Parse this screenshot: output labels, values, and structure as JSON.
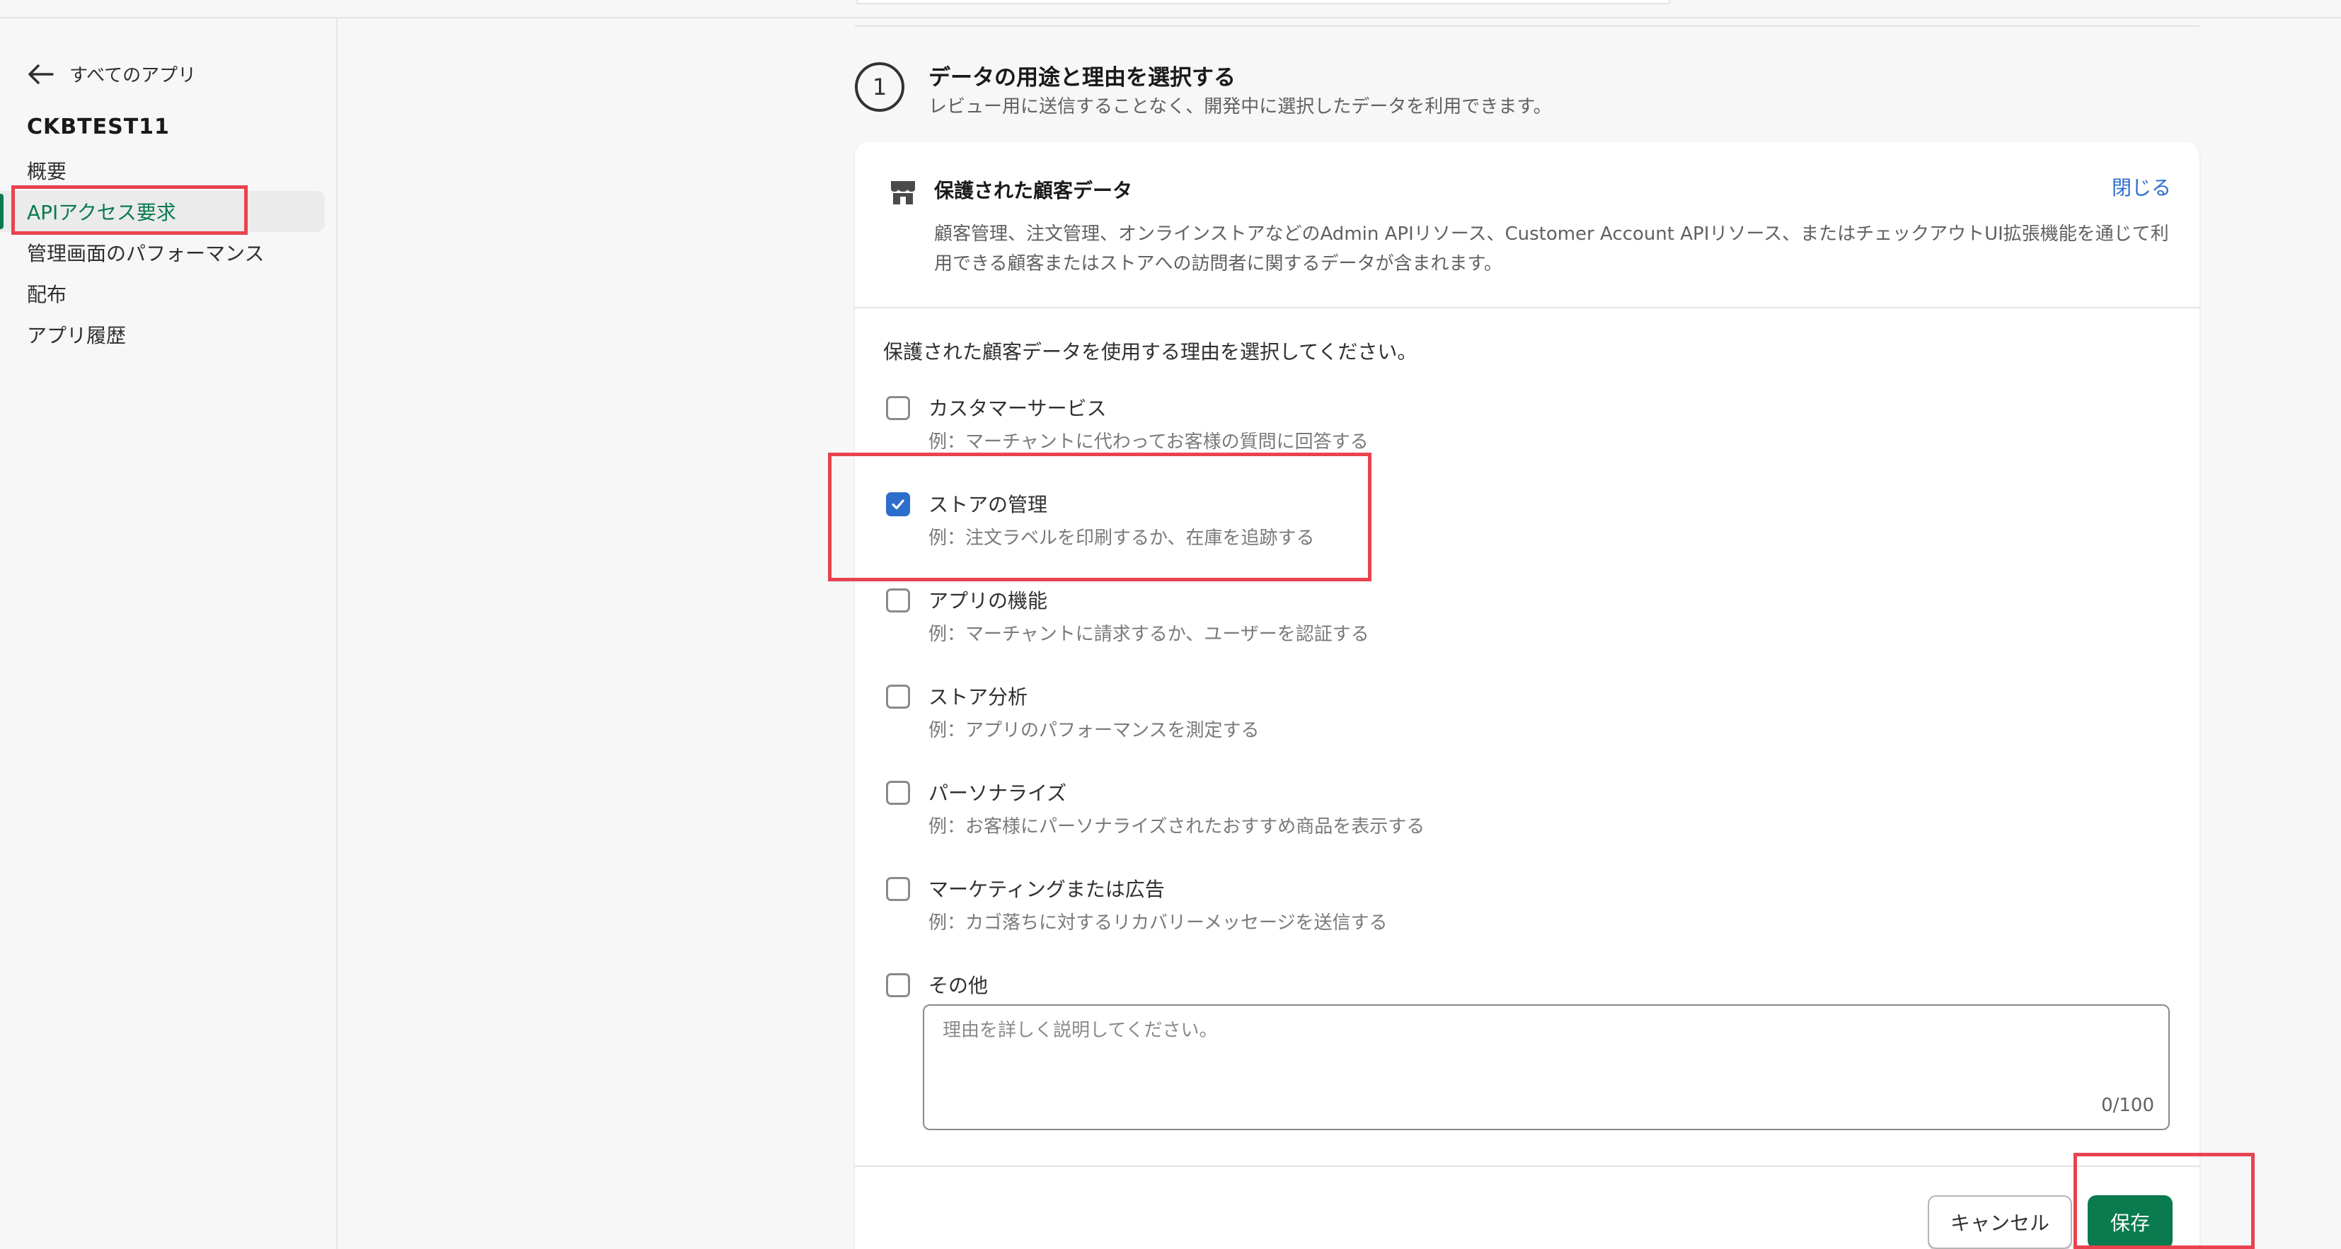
{
  "sidebar": {
    "back_label": "すべてのアプリ",
    "app_name": "CKBTEST11",
    "items": [
      {
        "label": "概要"
      },
      {
        "label": "APIアクセス要求"
      },
      {
        "label": "管理画面のパフォーマンス"
      },
      {
        "label": "配布"
      },
      {
        "label": "アプリ履歴"
      }
    ]
  },
  "section": {
    "step_number": "1",
    "title": "データの用途と理由を選択する",
    "subtitle": "レビュー用に送信することなく、開発中に選択したデータを利用できます。"
  },
  "card": {
    "title": "保護された顧客データ",
    "close_label": "閉じる",
    "description": "顧客管理、注文管理、オンラインストアなどのAdmin APIリソース、Customer Account APIリソース、またはチェックアウトUI拡張機能を通じて利用できる顧客またはストアへの訪問者に関するデータが含まれます。",
    "prompt": "保護された顧客データを使用する理由を選択してください。",
    "options": [
      {
        "label": "カスタマーサービス",
        "example": "例：マーチャントに代わってお客様の質問に回答する",
        "checked": false
      },
      {
        "label": "ストアの管理",
        "example": "例：注文ラベルを印刷するか、在庫を追跡する",
        "checked": true
      },
      {
        "label": "アプリの機能",
        "example": "例：マーチャントに請求するか、ユーザーを認証する",
        "checked": false
      },
      {
        "label": "ストア分析",
        "example": "例：アプリのパフォーマンスを測定する",
        "checked": false
      },
      {
        "label": "パーソナライズ",
        "example": "例：お客様にパーソナライズされたおすすめ商品を表示する",
        "checked": false
      },
      {
        "label": "マーケティングまたは広告",
        "example": "例：カゴ落ちに対するリカバリーメッセージを送信する",
        "checked": false
      },
      {
        "label": "その他",
        "checked": false
      }
    ],
    "reason": {
      "placeholder": "理由を詳しく説明してください。",
      "counter": "0/100"
    },
    "cancel_label": "キャンセル",
    "save_label": "保存"
  },
  "colors": {
    "accent_green": "#0a7a4f",
    "link_blue": "#2c6ecb",
    "annotation_red": "#e8434f"
  }
}
